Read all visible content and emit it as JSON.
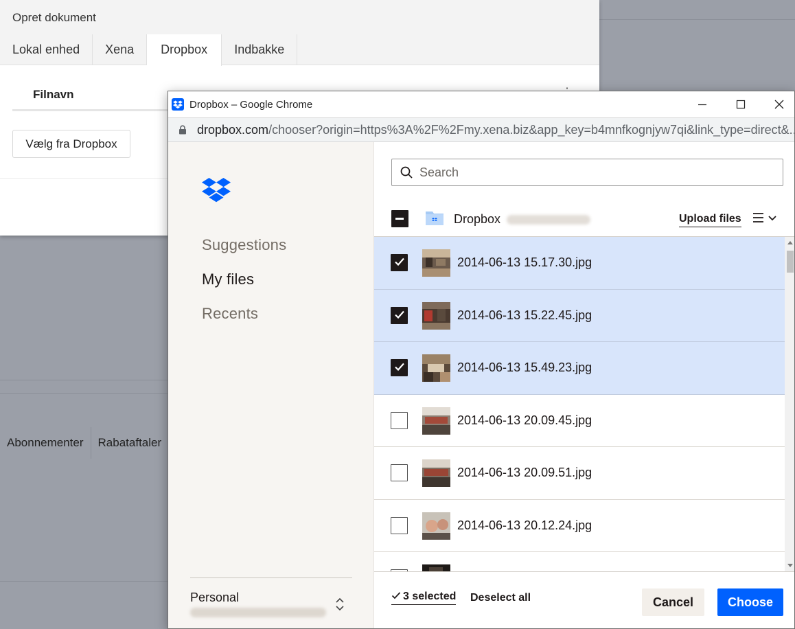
{
  "background": {
    "tabs": [
      "Abonnementer",
      "Rabataftaler"
    ]
  },
  "modal": {
    "title": "Opret dokument",
    "tabs": [
      {
        "label": "Lokal enhed",
        "active": false
      },
      {
        "label": "Xena",
        "active": false
      },
      {
        "label": "Dropbox",
        "active": true
      },
      {
        "label": "Indbakke",
        "active": false
      }
    ],
    "column_header": "Filnavn",
    "pick_button": "Vælg fra Dropbox"
  },
  "popup": {
    "window_title": "Dropbox – Google Chrome",
    "url_host": "dropbox.com",
    "url_rest": "/chooser?origin=https%3A%2F%2Fmy.xena.biz&app_key=b4mnfkognjyw7qi&link_type=direct&...",
    "sidebar": {
      "nav": [
        {
          "label": "Suggestions",
          "active": false
        },
        {
          "label": "My files",
          "active": true
        },
        {
          "label": "Recents",
          "active": false
        }
      ],
      "account_label": "Personal"
    },
    "search_placeholder": "Search",
    "breadcrumb": "Dropbox",
    "upload_label": "Upload files",
    "files": [
      {
        "name": "2014-06-13 15.17.30.jpg",
        "selected": true
      },
      {
        "name": "2014-06-13 15.22.45.jpg",
        "selected": true
      },
      {
        "name": "2014-06-13 15.49.23.jpg",
        "selected": true
      },
      {
        "name": "2014-06-13 20.09.45.jpg",
        "selected": false
      },
      {
        "name": "2014-06-13 20.09.51.jpg",
        "selected": false
      },
      {
        "name": "2014-06-13 20.12.24.jpg",
        "selected": false
      },
      {
        "name": "",
        "selected": false
      }
    ],
    "selected_count": "3 selected",
    "deselect_label": "Deselect all",
    "cancel_label": "Cancel",
    "choose_label": "Choose"
  },
  "colors": {
    "accent": "#0061fe",
    "selected_row": "#d8e5fb",
    "sidebar_bg": "#f7f5f2",
    "overlay": "#9b9fa8"
  }
}
